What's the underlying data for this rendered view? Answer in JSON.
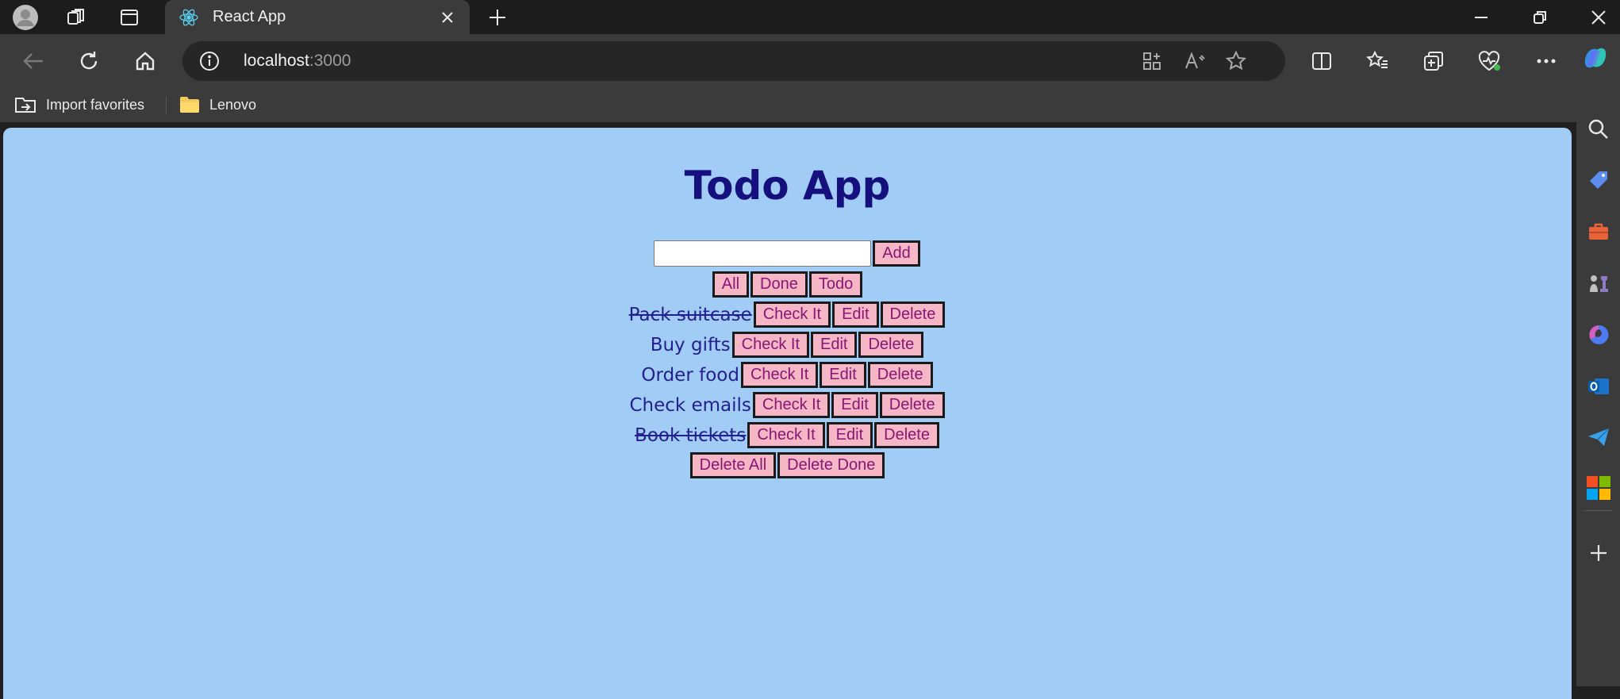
{
  "browser": {
    "tab_title": "React App",
    "url_host": "localhost",
    "url_port": ":3000",
    "favorites": [
      {
        "label": "Import favorites",
        "icon": "import-favorites-icon"
      },
      {
        "label": "Lenovo",
        "icon": "folder-icon"
      }
    ]
  },
  "app": {
    "title": "Todo App",
    "new_todo_value": "",
    "add_label": "Add",
    "filters": [
      "All",
      "Done",
      "Todo"
    ],
    "item_actions": {
      "check": "Check It",
      "edit": "Edit",
      "delete": "Delete"
    },
    "todos": [
      {
        "text": "Pack suitcase",
        "done": true
      },
      {
        "text": "Buy gifts",
        "done": false
      },
      {
        "text": "Order food",
        "done": false
      },
      {
        "text": "Check emails",
        "done": false
      },
      {
        "text": "Book tickets",
        "done": true
      }
    ],
    "delete_all_label": "Delete All",
    "delete_done_label": "Delete Done"
  },
  "colors": {
    "page_bg": "#a0ccf6",
    "title": "#16107f",
    "button_bg": "#f5b6c6",
    "button_text": "#8b1575",
    "item_text": "#241f8c"
  }
}
